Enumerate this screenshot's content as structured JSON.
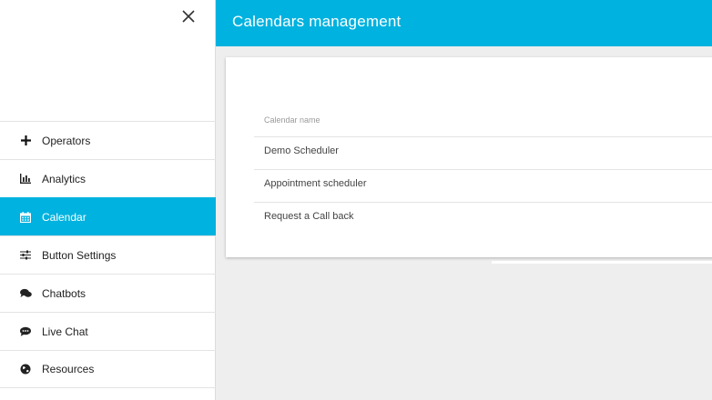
{
  "header": {
    "title": "Calendars management"
  },
  "sidebar": {
    "items": [
      {
        "label": "Operators",
        "icon": "plus-icon"
      },
      {
        "label": "Analytics",
        "icon": "bar-chart-icon"
      },
      {
        "label": "Calendar",
        "icon": "calendar-icon",
        "active": true
      },
      {
        "label": "Button Settings",
        "icon": "sliders-icon"
      },
      {
        "label": "Chatbots",
        "icon": "comments-icon"
      },
      {
        "label": "Live Chat",
        "icon": "comment-dots-icon"
      },
      {
        "label": "Resources",
        "icon": "globe-icon"
      }
    ]
  },
  "table": {
    "column_header": "Calendar name",
    "rows": [
      "Demo Scheduler",
      "Appointment scheduler",
      "Request a Call back"
    ]
  },
  "colors": {
    "accent": "#00b2df",
    "background": "#eeeeee"
  }
}
